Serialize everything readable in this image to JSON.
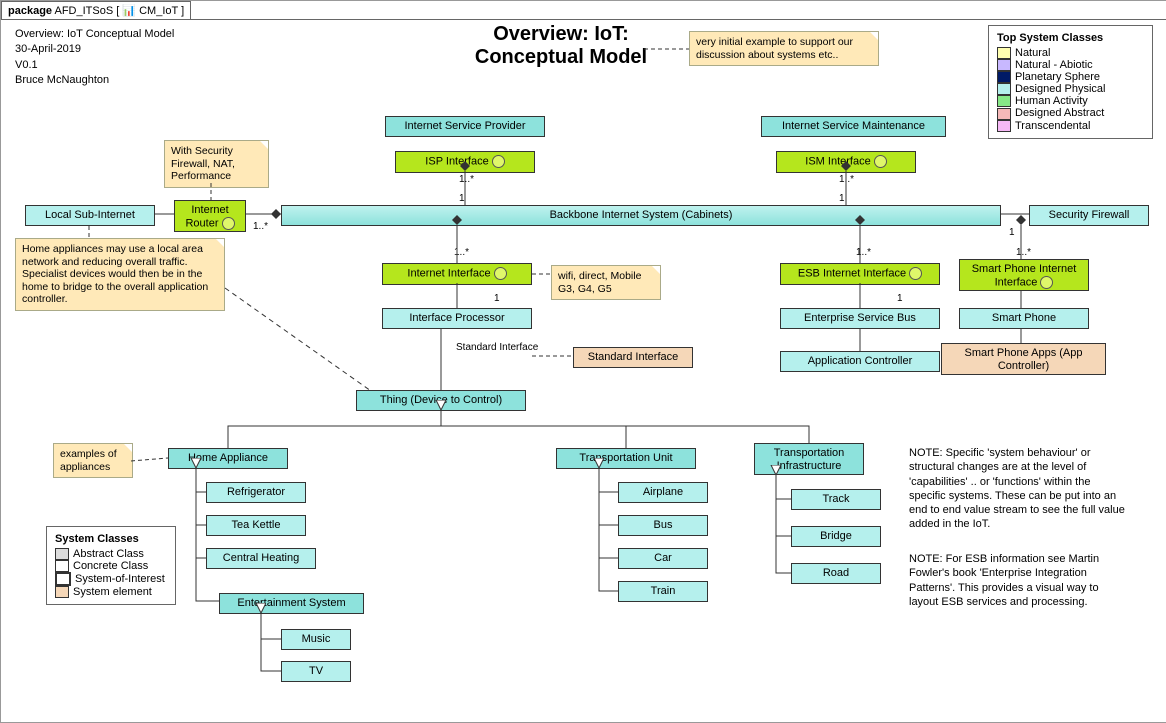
{
  "package": {
    "label": "package",
    "name": "AFD_ITSoS",
    "sub": "CM_IoT"
  },
  "title": {
    "l1": "Overview:  IoT:",
    "l2": "Conceptual Model"
  },
  "meta": {
    "l1": "Overview:  IoT Conceptual Model",
    "l2": "30-April-2019",
    "l3": "V0.1",
    "l4": "Bruce McNaughton"
  },
  "notes": {
    "initial": "very initial example to support our discussion about systems etc..",
    "router": "With Security Firewall, NAT, Performance",
    "lan": "Home appliances may use a local area network and reducing overall traffic.  Specialist devices would then be in the home to bridge to the overall application controller.",
    "wifi": "wifi, direct, Mobile G3, G4, G5",
    "appl": "examples of appliances",
    "stdlink": "Standard Interface",
    "n1": "NOTE:  Specific 'system behaviour' or structural changes are at the level of 'capabilities' .. or 'functions' within the specific systems.  These can be put into an end to end value stream to see the full value added in the IoT.",
    "n2": "NOTE:  For ESB information see Martin Fowler's book 'Enterprise Integration Patterns'.  This provides a visual way to layout ESB services and processing."
  },
  "legend1": {
    "title": "Top System Classes",
    "items": [
      {
        "label": "Natural",
        "c": "#ffffb0"
      },
      {
        "label": "Natural - Abiotic",
        "c": "#c8b8ff"
      },
      {
        "label": "Planetary Sphere",
        "c": "#001a66"
      },
      {
        "label": "Designed Physical",
        "c": "#b5f0ed"
      },
      {
        "label": "Human Activity",
        "c": "#87e887"
      },
      {
        "label": "Designed Abstract",
        "c": "#f5b8b8"
      },
      {
        "label": "Transcendental",
        "c": "#f5b8f5"
      }
    ]
  },
  "legend2": {
    "title": "System Classes",
    "items": [
      {
        "label": "Abstract Class",
        "c": "#ddd"
      },
      {
        "label": "Concrete Class",
        "c": "#fff"
      },
      {
        "label": "System-of-Interest",
        "c": "#fff"
      },
      {
        "label": "System element",
        "c": "#f5d7b8"
      }
    ]
  },
  "b": {
    "isp": "Internet Service Provider",
    "ispif": "ISP Interface",
    "ism": "Internet Service Maintenance",
    "ismif": "ISM Interface",
    "lsi": "Local Sub-Internet",
    "router": "Internet Router",
    "backbone": "Backbone Internet System (Cabinets)",
    "fw": "Security Firewall",
    "iif": "Internet Interface",
    "iproc": "Interface Processor",
    "esbif": "ESB Internet Interface",
    "esb": "Enterprise Service Bus",
    "appc": "Application Controller",
    "spif": "Smart Phone Internet Interface",
    "sp": "Smart Phone",
    "spapp": "Smart Phone Apps (App Controller)",
    "stdif": "Standard Interface",
    "thing": "Thing (Device to Control)",
    "ha": "Home Appliance",
    "fr": "Refrigerator",
    "tk": "Tea Kettle",
    "ch": "Central Heating",
    "ent": "Entertainment System",
    "mus": "Music",
    "tv": "TV",
    "tu": "Transportation Unit",
    "air": "Airplane",
    "bus": "Bus",
    "car": "Car",
    "tr": "Train",
    "ti": "Transportation Infrastructure",
    "trk": "Track",
    "brd": "Bridge",
    "road": "Road"
  },
  "mult": {
    "one": "1",
    "star": "1..*"
  }
}
